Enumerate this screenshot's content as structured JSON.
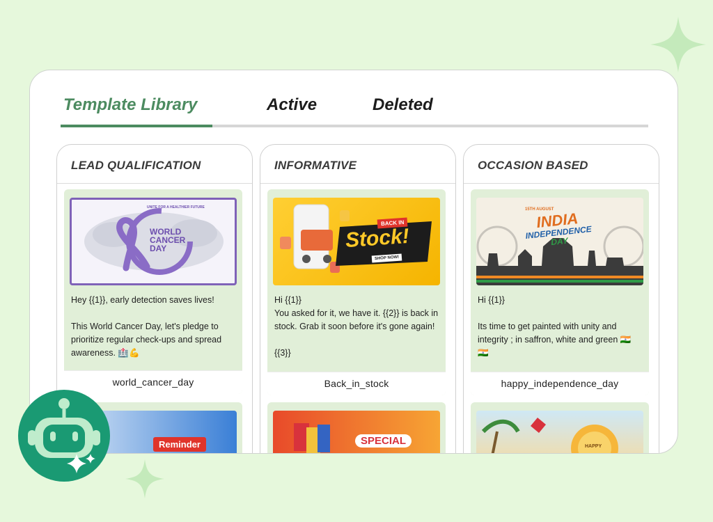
{
  "tabs": [
    {
      "label": "Template Library",
      "active": true
    },
    {
      "label": "Active",
      "active": false
    },
    {
      "label": "Deleted",
      "active": false
    }
  ],
  "columns": [
    {
      "title": "LEAD QUALIFICATION",
      "card": {
        "banner": {
          "line1": "WORLD",
          "line2": "CANCER",
          "line3": "DAY",
          "arc_text": "UNITE FOR A HEALTHIER FUTURE"
        },
        "body": [
          "Hey  {{1}}, early detection saves lives!",
          "This World Cancer Day, let's pledge to prioritize regular check-ups and spread awareness. 🏥💪"
        ],
        "name": "world_cancer_day"
      },
      "next_banner": {
        "label": "Reminder"
      }
    },
    {
      "title": "INFORMATIVE",
      "card": {
        "banner": {
          "tag": "BACK IN",
          "headline": "Stock!",
          "cta": "SHOP NOW!"
        },
        "body": [
          "Hi {{1}}\nYou asked for it, we have it. {{2}} is back in stock. Grab it soon before it's gone again!",
          "{{3}}"
        ],
        "name": "Back_in_stock"
      },
      "next_banner": {
        "label": "SPECIAL"
      }
    },
    {
      "title": "OCCASION BASED",
      "card": {
        "banner": {
          "kicker": "15TH AUGUST",
          "line1": "INDIA",
          "line2": "INDEPENDENCE",
          "line3": "DAY"
        },
        "body": [
          "Hi {{1}}",
          "Its time to get painted with unity and integrity ; in saffron, white and green  🇮🇳 🇮🇳"
        ],
        "name": "happy_independence_day"
      },
      "next_banner": {
        "label": "HAPPY"
      }
    }
  ],
  "colors": {
    "background": "#e6f8dc",
    "accent": "#4c8b60",
    "card": "#e1efd8",
    "bot": "#1a9a73"
  },
  "icons": [
    "sparkle-icon",
    "chatbot-icon"
  ]
}
